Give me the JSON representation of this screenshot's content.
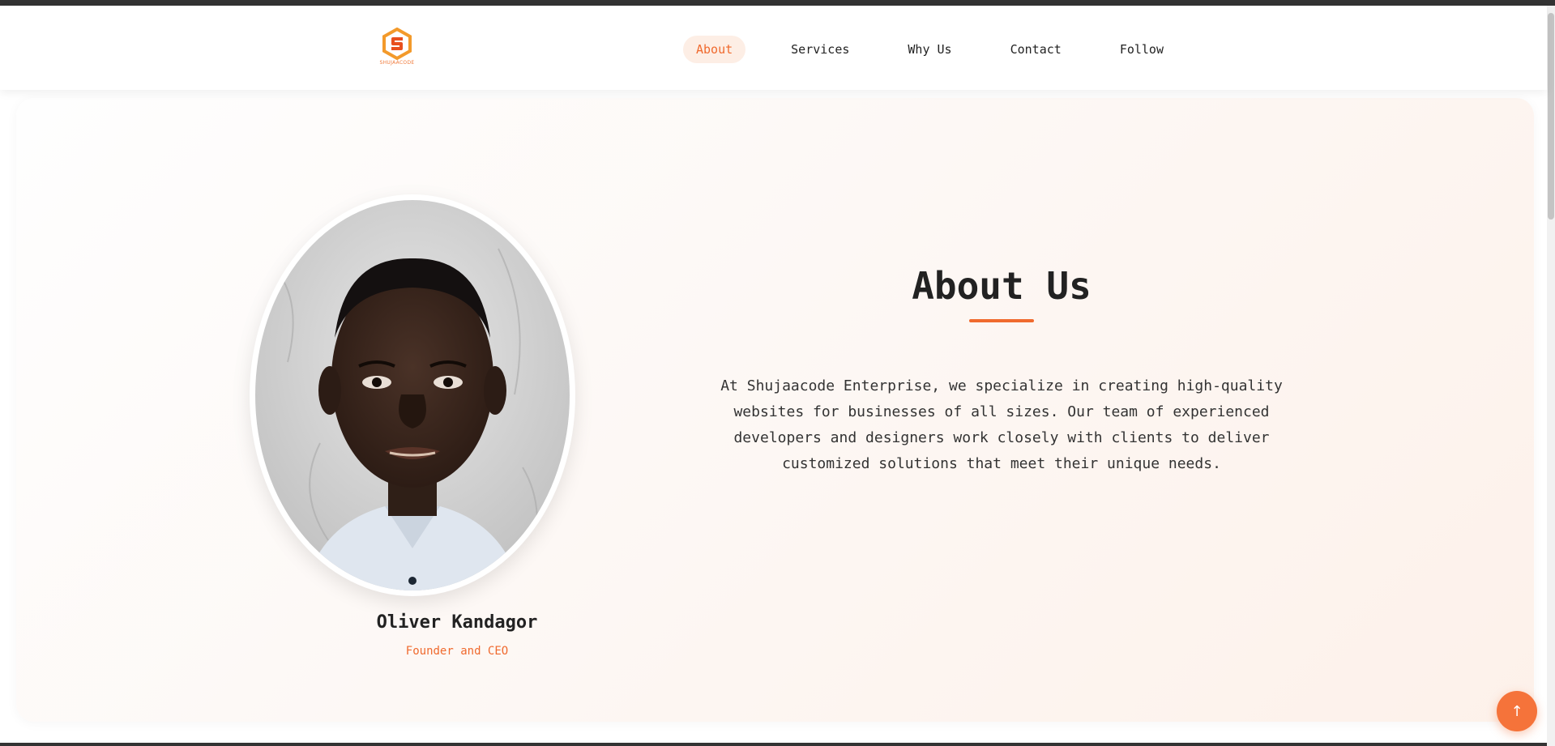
{
  "brand": {
    "logo_text": "SHUJAACODE",
    "accent_color": "#f06a2e"
  },
  "nav": {
    "items": [
      {
        "label": "About",
        "active": true
      },
      {
        "label": "Services",
        "active": false
      },
      {
        "label": "Why Us",
        "active": false
      },
      {
        "label": "Contact",
        "active": false
      },
      {
        "label": "Follow",
        "active": false
      }
    ]
  },
  "profile": {
    "name": "Oliver Kandagor",
    "role": "Founder and CEO"
  },
  "about": {
    "title": "About Us",
    "body": "At Shujaacode Enterprise, we specialize in creating high-quality websites for businesses of all sizes. Our team of experienced developers and designers work closely with clients to deliver customized solutions that meet their unique needs."
  },
  "scroll_top": {
    "icon": "arrow-up-icon",
    "glyph": "↑"
  }
}
